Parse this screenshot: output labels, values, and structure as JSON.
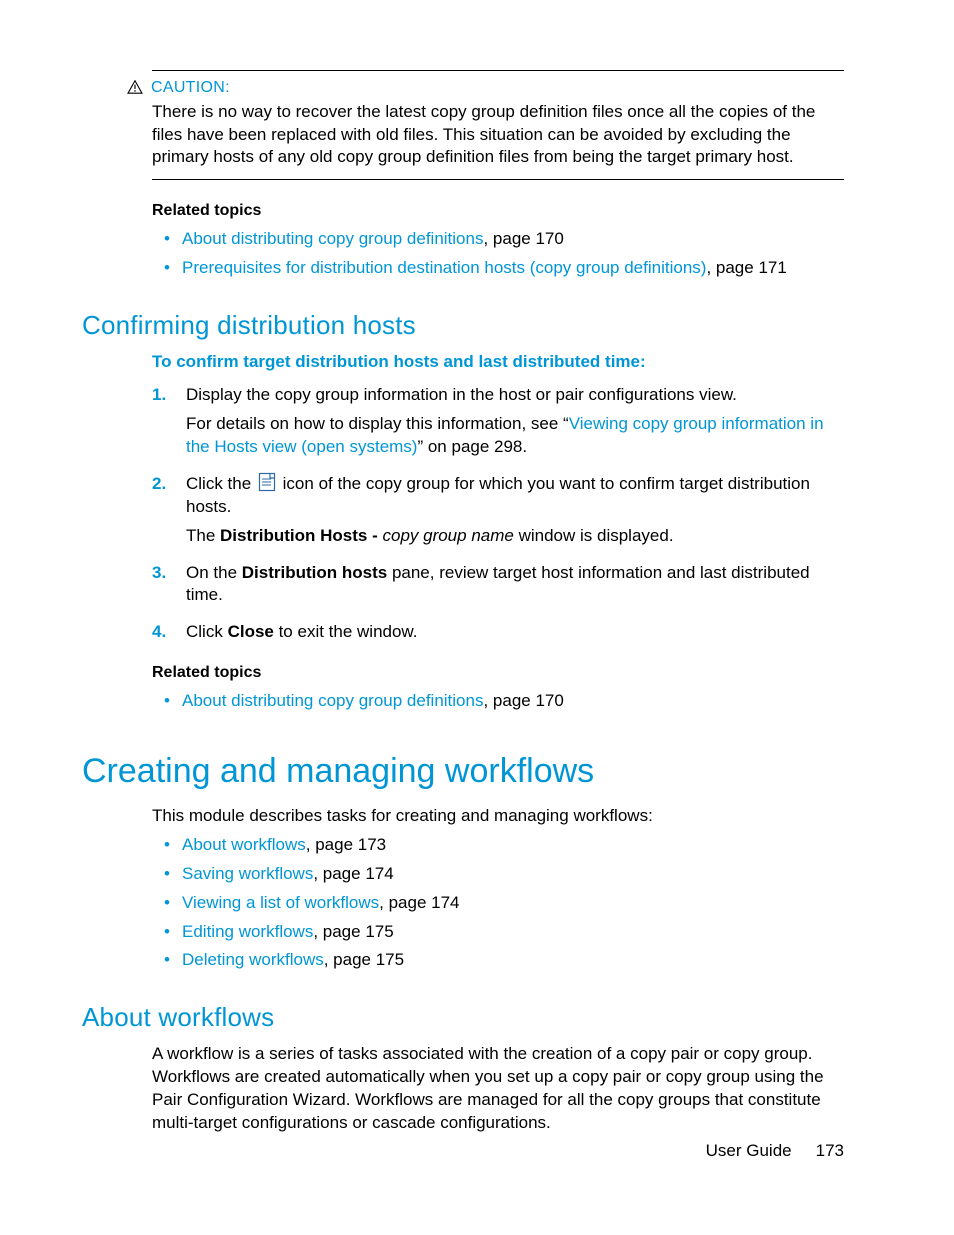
{
  "caution": {
    "label": "CAUTION:",
    "text": "There is no way to recover the latest copy group definition files once all the copies of the files have been replaced with old files. This situation can be avoided by excluding the primary hosts of any old copy group definition files from being the target primary host."
  },
  "related1": {
    "heading": "Related topics",
    "items": [
      {
        "link": "About distributing copy group definitions",
        "suffix": ", page 170"
      },
      {
        "link": "Prerequisites for distribution destination hosts (copy group definitions)",
        "suffix": ", page 171"
      }
    ]
  },
  "section1": {
    "title": "Confirming distribution hosts",
    "subhead": "To confirm target distribution hosts and last distributed time:",
    "step1": {
      "line1": "Display the copy group information in the host or pair configurations view.",
      "line2a": "For details on how to display this information, see “",
      "link": "Viewing copy group information in the Hosts view (open systems)",
      "line2b": "” on page 298."
    },
    "step2": {
      "pre": "Click the ",
      "post": " icon of the copy group for which you want to confirm target distribution hosts.",
      "sub_pre": "The ",
      "bold": "Distribution Hosts - ",
      "italic": "copy group name",
      "sub_post": " window is displayed."
    },
    "step3": {
      "pre": "On the ",
      "bold": "Distribution hosts",
      "post": " pane, review target host information and last distributed time."
    },
    "step4": {
      "pre": "Click ",
      "bold": "Close",
      "post": " to exit the window."
    }
  },
  "related2": {
    "heading": "Related topics",
    "items": [
      {
        "link": "About distributing copy group definitions",
        "suffix": ", page 170"
      }
    ]
  },
  "section2": {
    "title": "Creating and managing workflows",
    "intro": "This module describes tasks for creating and managing workflows:",
    "items": [
      {
        "link": "About workflows",
        "suffix": ", page 173"
      },
      {
        "link": "Saving workflows",
        "suffix": ", page 174"
      },
      {
        "link": "Viewing a list of workflows",
        "suffix": ", page 174"
      },
      {
        "link": "Editing workflows",
        "suffix": ", page 175"
      },
      {
        "link": "Deleting workflows",
        "suffix": ", page 175"
      }
    ]
  },
  "section3": {
    "title": "About workflows",
    "body": "A workflow is a series of tasks associated with the creation of a copy pair or copy group.  Workflows are created automatically when you set up a copy pair or copy group using the Pair Configuration Wizard. Workflows are managed for all the copy groups that constitute multi-target configurations or cascade configurations."
  },
  "footer": {
    "label": "User Guide",
    "page": "173"
  }
}
